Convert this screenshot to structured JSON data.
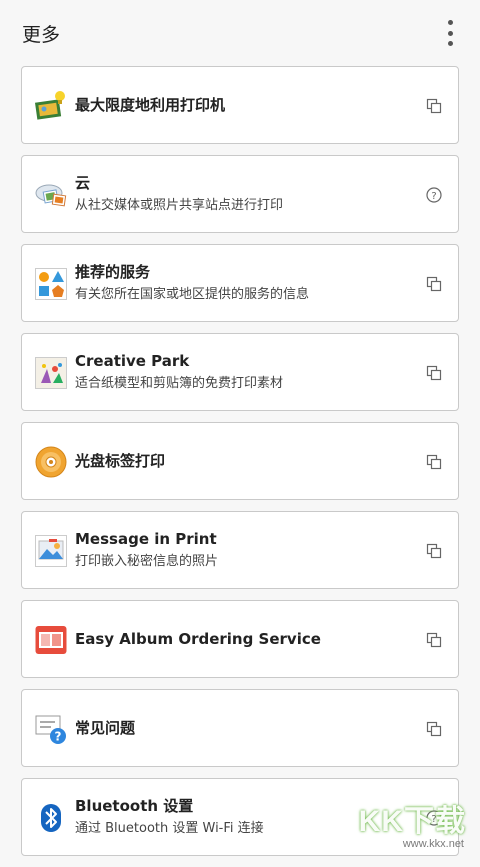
{
  "header": {
    "title": "更多",
    "menu_icon": "more-vert-icon"
  },
  "items": [
    {
      "title": "最大限度地利用打印机",
      "subtitle": "",
      "icon": "printer-tips-icon",
      "action": "open-external-icon"
    },
    {
      "title": "云",
      "subtitle": "从社交媒体或照片共享站点进行打印",
      "icon": "cloud-photos-icon",
      "action": "help-icon"
    },
    {
      "title": "推荐的服务",
      "subtitle": "有关您所在国家或地区提供的服务的信息",
      "icon": "services-shapes-icon",
      "action": "open-external-icon"
    },
    {
      "title": "Creative Park",
      "subtitle": "适合纸模型和剪贴簿的免费打印素材",
      "icon": "creative-park-icon",
      "action": "open-external-icon"
    },
    {
      "title": "光盘标签打印",
      "subtitle": "",
      "icon": "disc-icon",
      "action": "open-external-icon"
    },
    {
      "title": "Message in Print",
      "subtitle": "打印嵌入秘密信息的照片",
      "icon": "message-print-icon",
      "action": "open-external-icon"
    },
    {
      "title": "Easy Album Ordering Service",
      "subtitle": "",
      "icon": "album-icon",
      "action": "open-external-icon"
    },
    {
      "title": "常见问题",
      "subtitle": "",
      "icon": "faq-icon",
      "action": "open-external-icon"
    },
    {
      "title": "Bluetooth 设置",
      "subtitle": "通过 Bluetooth 设置 Wi-Fi 连接",
      "icon": "bluetooth-icon",
      "action": "help-icon"
    }
  ],
  "watermark": {
    "big": "KK下载",
    "small": "www.kkx.net"
  }
}
